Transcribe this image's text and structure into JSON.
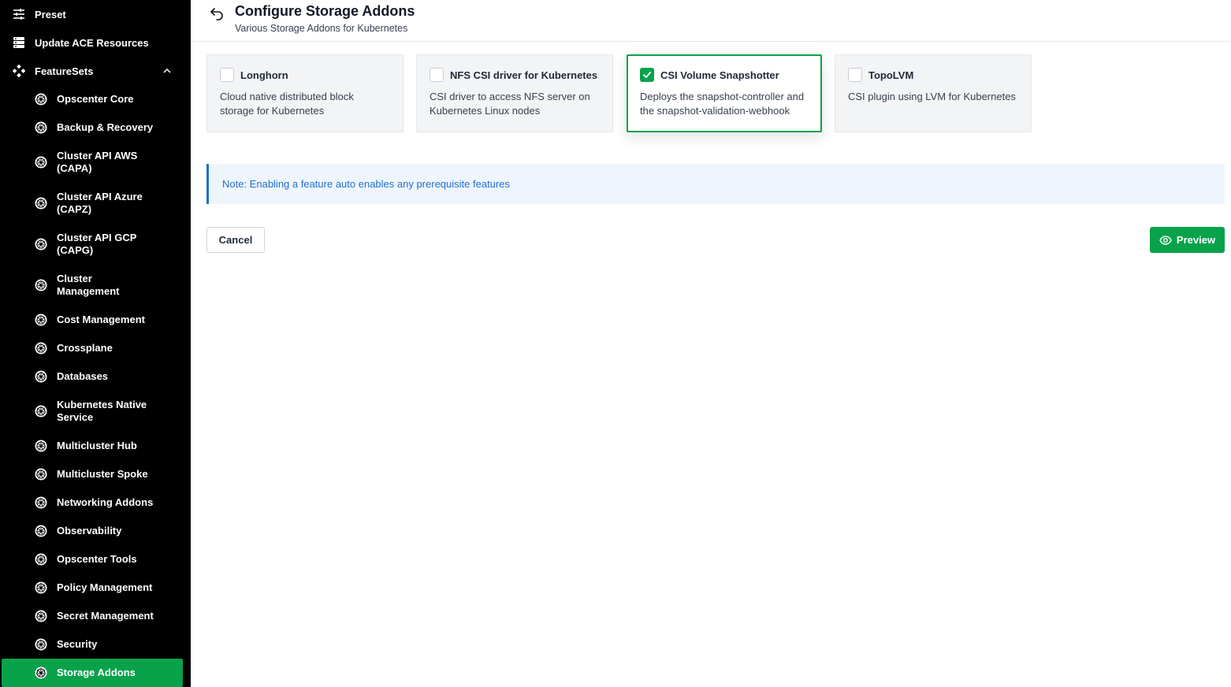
{
  "sidebar": {
    "top_items": [
      {
        "label": "Preset",
        "icon": "sliders-icon"
      },
      {
        "label": "Update ACE Resources",
        "icon": "server-icon"
      },
      {
        "label": "FeatureSets",
        "icon": "featuresets-icon"
      }
    ],
    "featuresets": [
      {
        "label": "Opscenter Core"
      },
      {
        "label": "Backup & Recovery"
      },
      {
        "label": "Cluster API AWS (CAPA)"
      },
      {
        "label": "Cluster API Azure (CAPZ)"
      },
      {
        "label": "Cluster API GCP (CAPG)"
      },
      {
        "label": "Cluster Management"
      },
      {
        "label": "Cost Management"
      },
      {
        "label": "Crossplane"
      },
      {
        "label": "Databases"
      },
      {
        "label": "Kubernetes Native Service"
      },
      {
        "label": "Multicluster Hub"
      },
      {
        "label": "Multicluster Spoke"
      },
      {
        "label": "Networking Addons"
      },
      {
        "label": "Observability"
      },
      {
        "label": "Opscenter Tools"
      },
      {
        "label": "Policy Management"
      },
      {
        "label": "Secret Management"
      },
      {
        "label": "Security"
      },
      {
        "label": "Storage Addons"
      }
    ],
    "active_item": "Storage Addons"
  },
  "header": {
    "title": "Configure Storage Addons",
    "subtitle": "Various Storage Addons for Kubernetes"
  },
  "cards": [
    {
      "title": "Longhorn",
      "description": "Cloud native distributed block storage for Kubernetes",
      "checked": false
    },
    {
      "title": "NFS CSI driver for Kubernetes",
      "description": "CSI driver to access NFS server on Kubernetes Linux nodes",
      "checked": false
    },
    {
      "title": "CSI Volume Snapshotter",
      "description": "Deploys the snapshot-controller and the snapshot-validation-webhook",
      "checked": true
    },
    {
      "title": "TopoLVM",
      "description": "CSI plugin using LVM for Kubernetes",
      "checked": false
    }
  ],
  "note": "Note: Enabling a feature auto enables any prerequisite features",
  "buttons": {
    "cancel": "Cancel",
    "preview": "Preview"
  },
  "colors": {
    "accent": "#07a24a",
    "sidebar_bg": "#000000",
    "note_text": "#1f6fd0",
    "note_bg": "#eff5fd"
  }
}
